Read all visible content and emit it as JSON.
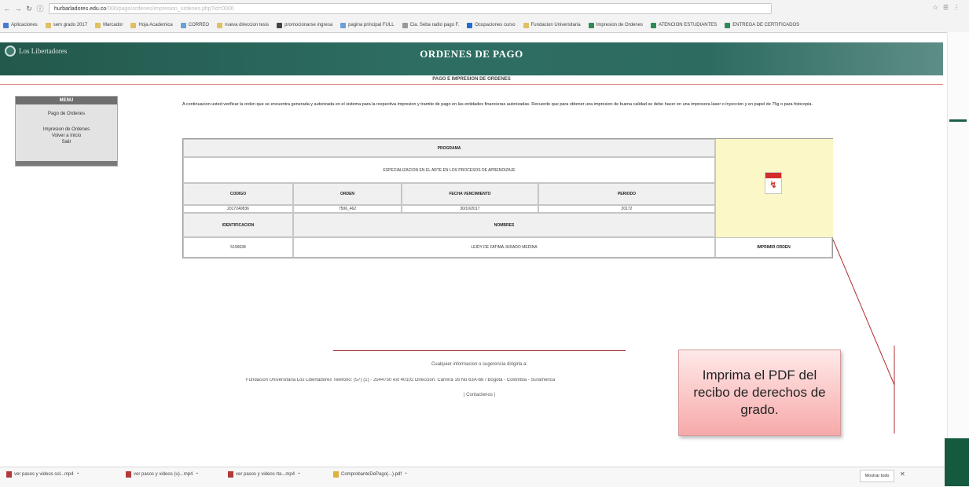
{
  "browser": {
    "url_host": "hurbarladores.edu.co",
    "url_path": "/000/pago/ordenes/impresion_ordenes.php?id=0000",
    "bookmarks": [
      {
        "label": "Aplicaciones",
        "color": "#4a7bd0"
      },
      {
        "label": "sem grado 2017",
        "color": "#e0c060"
      },
      {
        "label": "Marcador",
        "color": "#e0c060"
      },
      {
        "label": "Hoja Academica",
        "color": "#e0c060"
      },
      {
        "label": "CORREO",
        "color": "#6aa0d8"
      },
      {
        "label": "nueva direccion tesis",
        "color": "#e0c060"
      },
      {
        "label": "promocionarse ingresa",
        "color": "#444"
      },
      {
        "label": "pagina principal FULL",
        "color": "#6aa0d8"
      },
      {
        "label": "Cia. Seba radio pago F.",
        "color": "#999"
      },
      {
        "label": "Ocupaciones curso",
        "color": "#1e6fd0"
      },
      {
        "label": "Fundacion Universitaria",
        "color": "#e0c060"
      },
      {
        "label": "Impresion de Ordenes",
        "color": "#2e8b57"
      },
      {
        "label": "ATENCION ESTUDIANTES",
        "color": "#2e8b57"
      },
      {
        "label": "ENTREGA DE CERTIFICADOS",
        "color": "#2e8b57"
      }
    ]
  },
  "header": {
    "logo_text": "Los Libertadores",
    "title": "ORDENES DE PAGO",
    "subtitle": "PAGO E IMPRESION DE ORDENES"
  },
  "menu": {
    "heading": "MENU",
    "items": [
      "Pago de Ordenes",
      "Impresion de Ordenes",
      "Volver a Inicio",
      "Salir"
    ]
  },
  "intro_text": "A continuacion usted verificar la orden que se encuentra generada y autorizada en el sistema para la respectiva impresion y tramite de pago en las entidades financieras autorizadas. Recuerde que para obtener una impresion de buena calidad se debe hacer en una impresora laser o inyeccion y en papel de 75g o para fotocopia.",
  "order_table": {
    "program_header": "PROGRAMA",
    "program_value": "ESPECIALIZACION EN EL ARTE EN LOS PROCESOS DE APRENDIZAJE",
    "headers": [
      "CODIGO",
      "ORDEN",
      "FECHA VENCIMIENTO",
      "PERIODO"
    ],
    "values": [
      "2017240836",
      "7506_462",
      "30/10/2017",
      "20172"
    ],
    "ident_header": "IDENTIFICACION",
    "names_header": "NOMBRES",
    "ident_value": "5190638",
    "names_value": "LEIDY DE FATIMA JURADO MEDINA",
    "print_label": "IMPRIMIR ORDEN"
  },
  "footer": {
    "line1": "Cualquier informacion o sugerencia dirigirla a:",
    "line2": "Fundacion Universitaria Los Libertadores Telefono: (57) (1) - 2544750 ext 40102 Direccion: Carrera 16 No 63A-68 / Bogota - Colombia - Suramerica",
    "line3": "| Contactenos |"
  },
  "callout": {
    "text": "Imprima el PDF del recibo de derechos de grado."
  },
  "downloads": {
    "items": [
      "ver pasos y videos sol...mp4",
      "ver pasos y videos (u)...mp4",
      "ver pasos y videos rta...mp4",
      "ComprobanteDePago(...).pdf"
    ],
    "show_all": "Mostrar todo"
  },
  "colors": {
    "banner": "#2e6e62",
    "pdf_cell_bg": "#fbf7c6",
    "callout_bg": "#f7a9a9",
    "accent_line": "#9b2020"
  }
}
